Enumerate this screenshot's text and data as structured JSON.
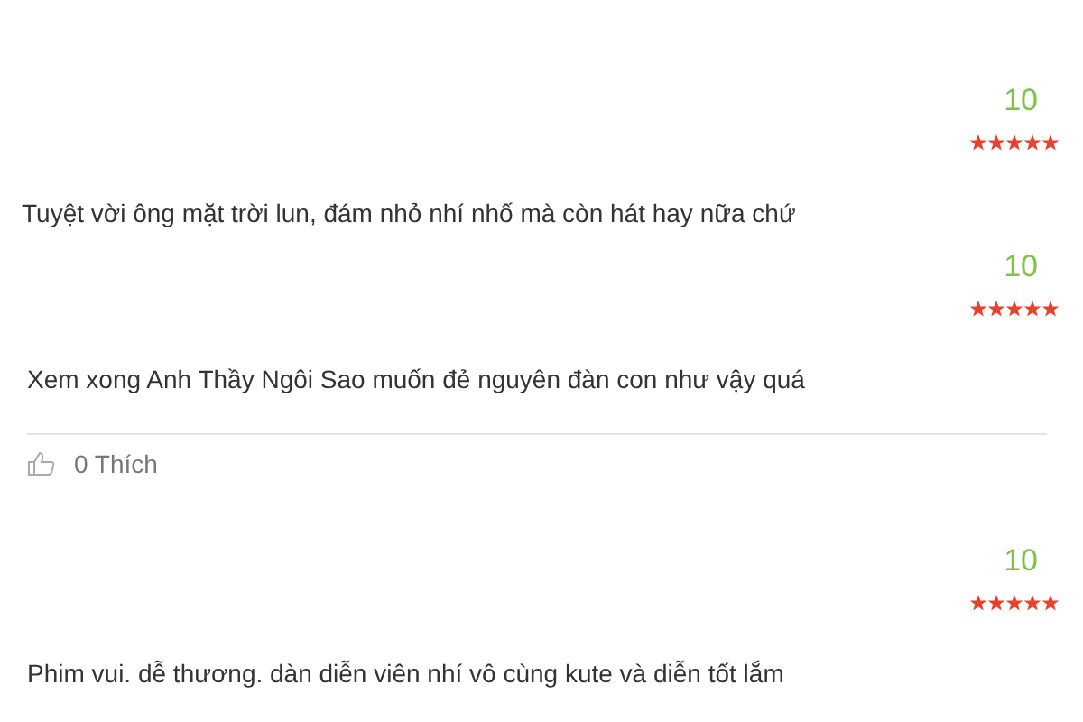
{
  "reviews": [
    {
      "score": "10",
      "stars": 5,
      "text": "Tuyệt vời ông mặt trời lun, đám nhỏ nhí nhố mà còn hát hay nữa chứ"
    },
    {
      "score": "10",
      "stars": 5,
      "text": "Xem xong Anh Thầy Ngôi Sao muốn đẻ nguyên đàn con như vậy quá",
      "likes": "0 Thích"
    },
    {
      "score": "10",
      "stars": 5,
      "text": "Phim vui. dễ thương. dàn diễn viên nhí vô cùng kute và diễn tốt lắm"
    }
  ]
}
